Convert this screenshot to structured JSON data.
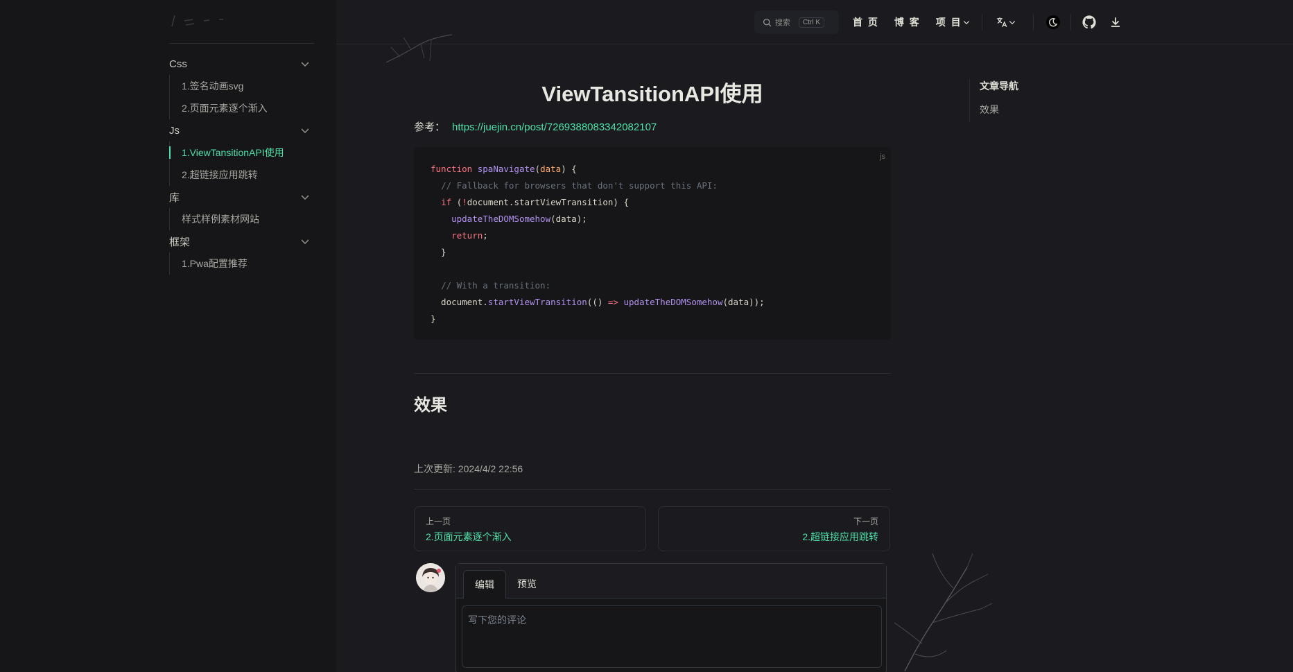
{
  "sidebar": {
    "groups": [
      {
        "label": "Css",
        "items": [
          {
            "label": "1.签名动画svg"
          },
          {
            "label": "2.页面元素逐个渐入"
          }
        ]
      },
      {
        "label": "Js",
        "items": [
          {
            "label": "1.ViewTansitionAPI使用",
            "active": true
          },
          {
            "label": "2.超链接应用跳转"
          }
        ]
      },
      {
        "label": "库",
        "items": [
          {
            "label": "样式样例素材网站"
          }
        ]
      },
      {
        "label": "框架",
        "items": [
          {
            "label": "1.Pwa配置推荐"
          }
        ]
      }
    ]
  },
  "topbar": {
    "search_placeholder": "搜索",
    "search_shortcut": "Ctrl K",
    "links": {
      "home": "首 页",
      "blog": "博 客",
      "projects": "项 目"
    }
  },
  "article": {
    "title": "ViewTansitionAPI使用",
    "ref_label": "参考：",
    "ref_url": "https://juejin.cn/post/7269388083342082107",
    "code_lang": "js",
    "section_heading": "效果",
    "last_updated": "上次更新: 2024/4/2 22:56"
  },
  "pager": {
    "prev_label": "上一页",
    "prev_title": "2.页面元素逐个渐入",
    "next_label": "下一页",
    "next_title": "2.超链接应用跳转"
  },
  "comment": {
    "tab_edit": "编辑",
    "tab_preview": "预览",
    "placeholder": "写下您的评论"
  },
  "outline": {
    "title": "文章导航",
    "items": [
      "效果"
    ]
  },
  "colors": {
    "accent": "#4ee0a8",
    "background": "#1b1b1f",
    "sidebar": "#161618"
  }
}
